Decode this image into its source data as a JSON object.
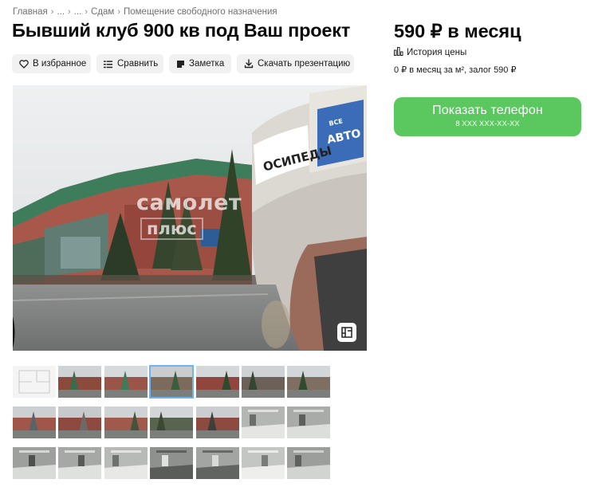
{
  "breadcrumb": [
    {
      "label": "Главная"
    },
    {
      "label": "..."
    },
    {
      "label": "..."
    },
    {
      "label": "Сдам"
    },
    {
      "label": "Помещение свободного назначения"
    }
  ],
  "title": "Бывший клуб 900 кв под Ваш проект",
  "actions": {
    "favorite": "В избранное",
    "compare": "Сравнить",
    "note": "Заметка",
    "download": "Скачать презентацию"
  },
  "gallery": {
    "watermark_top": "самолет",
    "watermark_bottom": "плюс",
    "photo_signs": [
      "ОСИПЕДЫ",
      "АВТО",
      "ВСЕ"
    ],
    "thumb_count": 21,
    "selected_thumb": 3
  },
  "price": {
    "main": "590 ₽ в месяц",
    "history": "История цены",
    "details": "0 ₽ в месяц за м², залог 590 ₽"
  },
  "phone": {
    "label": "Показать телефон",
    "number": "8 XXX XXX-XX-XX"
  },
  "colors": {
    "accent_green": "#5ac85f",
    "button_gray": "#f1f1f1",
    "selected_outline": "#6fb2f2"
  }
}
